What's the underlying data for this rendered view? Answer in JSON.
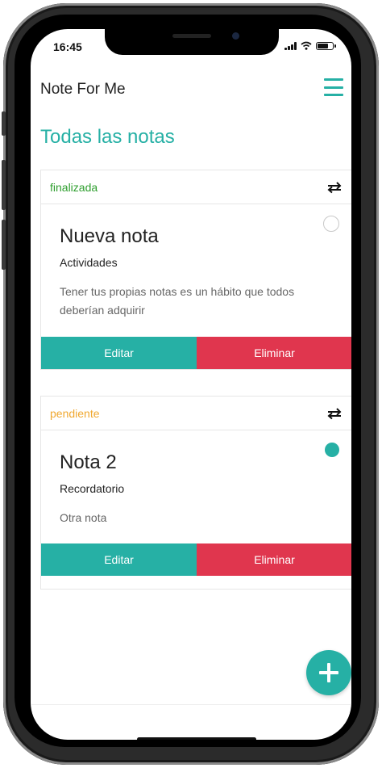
{
  "status_bar": {
    "time": "16:45",
    "battery_level": 0.7
  },
  "app": {
    "title": "Note For Me"
  },
  "page": {
    "title": "Todas las notas"
  },
  "colors": {
    "accent": "#26b0a5",
    "danger": "#e0364e",
    "done": "#2e9e2e",
    "pending": "#f0a830"
  },
  "notes": [
    {
      "status": "finalizada",
      "status_color": "#2e9e2e",
      "title": "Nueva nota",
      "category": "Actividades",
      "text": "Tener tus propias notas es un hábito que todos deberían adquirir",
      "completed": false,
      "edit_label": "Editar",
      "delete_label": "Eliminar"
    },
    {
      "status": "pendiente",
      "status_color": "#f0a830",
      "title": "Nota 2",
      "category": "Recordatorio",
      "text": "Otra nota",
      "completed": true,
      "edit_label": "Editar",
      "delete_label": "Eliminar"
    }
  ],
  "icons": {
    "menu": "hamburger-menu-icon",
    "swap": "swap-arrows-icon",
    "add": "plus-icon"
  }
}
